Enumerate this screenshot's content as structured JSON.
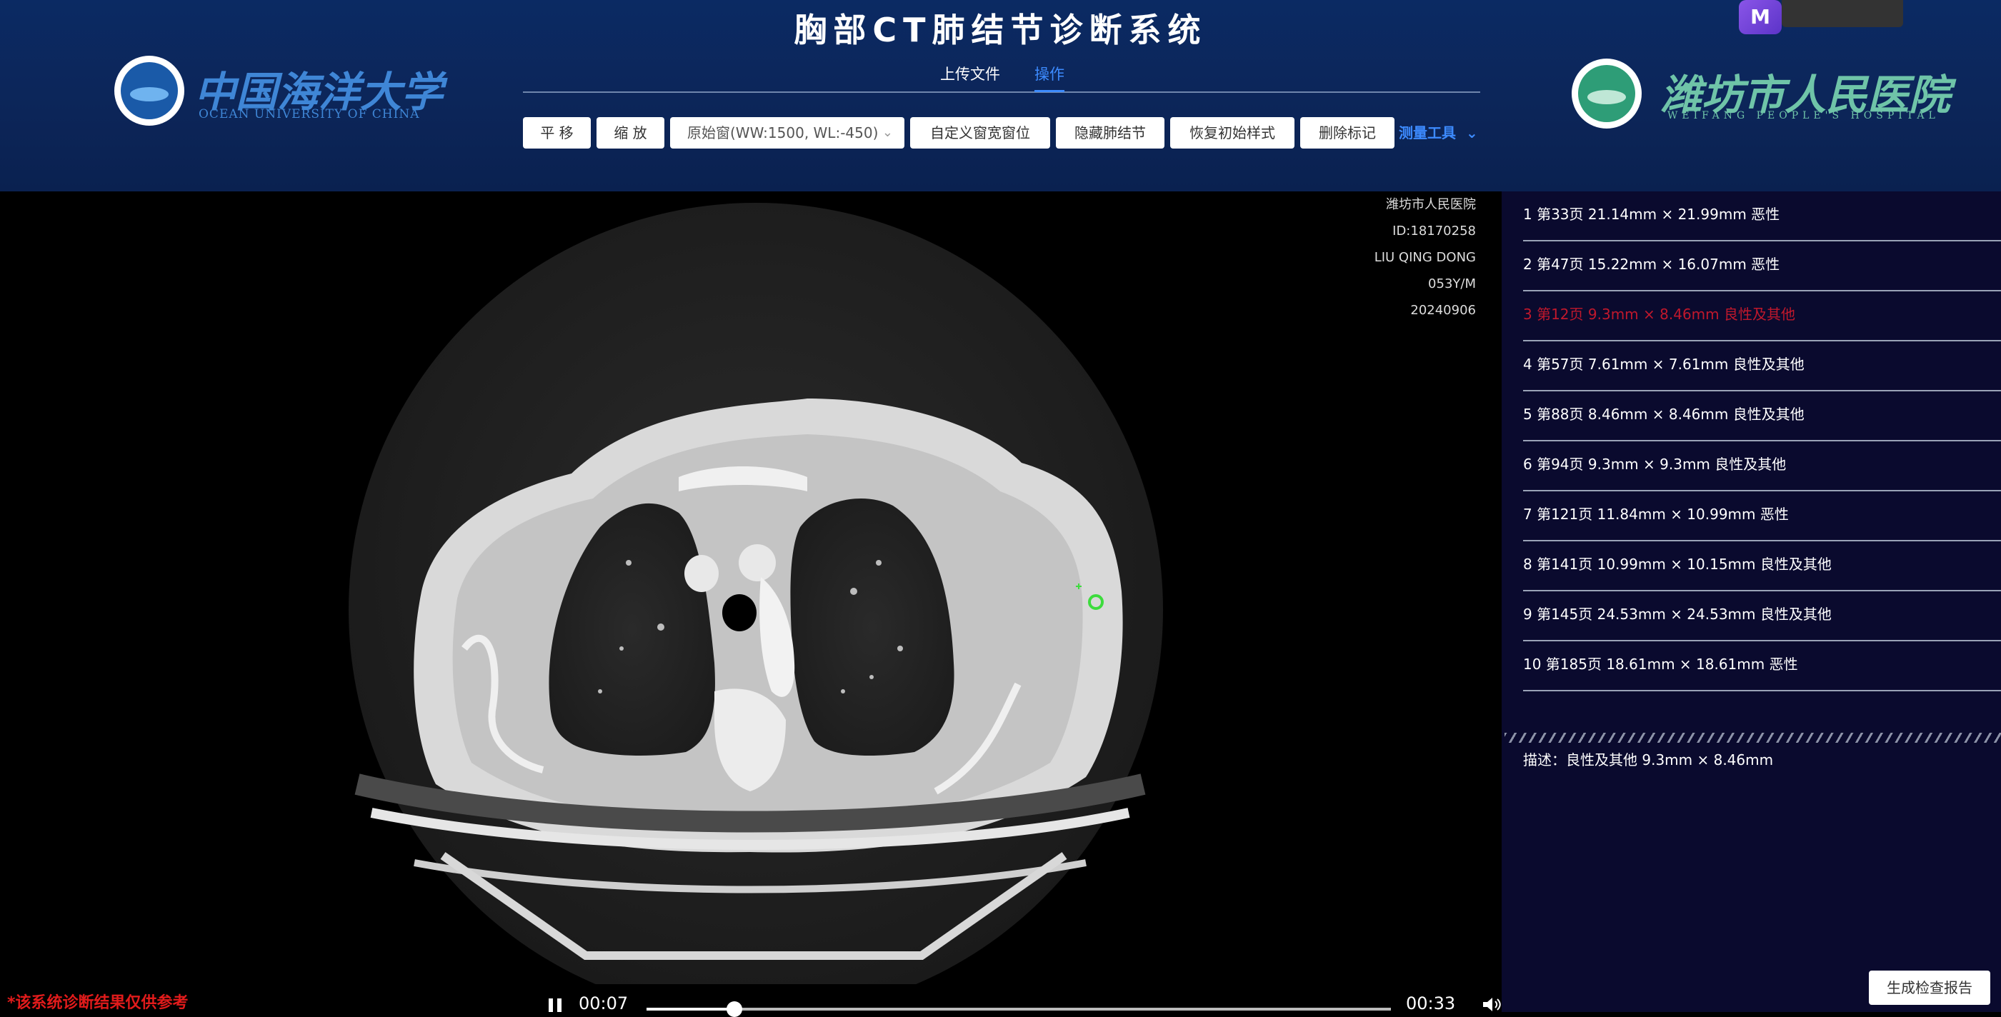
{
  "app": {
    "title": "胸部CT肺结节诊断系统",
    "logo_left": {
      "cn": "中国海洋大学",
      "en": "OCEAN UNIVERSITY OF CHINA",
      "seal": "OUC"
    },
    "logo_right": {
      "cn": "潍坊市人民医院",
      "en": "WEIFANG PEOPLE'S HOSPITAL"
    }
  },
  "tabs": [
    {
      "label": "上传文件",
      "active": false
    },
    {
      "label": "操作",
      "active": true
    }
  ],
  "toolbar": {
    "pan": "平 移",
    "zoom": "缩 放",
    "window_select": "原始窗(WW:1500, WL:-450)",
    "custom_window": "自定义窗宽窗位",
    "hide_nodules": "隐藏肺结节",
    "restore": "恢复初始样式",
    "delete_marks": "删除标记",
    "measure_tools": "测量工具"
  },
  "patient_info": {
    "hospital": "潍坊市人民医院",
    "id": "ID:18170258",
    "name": "LIU QING DONG",
    "age_sex": "053Y/M",
    "date": "20240906"
  },
  "nodules": [
    {
      "text": "1 第33页 21.14mm × 21.99mm 恶性",
      "selected": false
    },
    {
      "text": "2 第47页 15.22mm × 16.07mm 恶性",
      "selected": false
    },
    {
      "text": "3 第12页 9.3mm × 8.46mm 良性及其他",
      "selected": true
    },
    {
      "text": "4 第57页 7.61mm × 7.61mm 良性及其他",
      "selected": false
    },
    {
      "text": "5 第88页 8.46mm × 8.46mm 良性及其他",
      "selected": false
    },
    {
      "text": "6 第94页 9.3mm × 9.3mm 良性及其他",
      "selected": false
    },
    {
      "text": "7 第121页 11.84mm × 10.99mm 恶性",
      "selected": false
    },
    {
      "text": "8 第141页 10.99mm × 10.15mm 良性及其他",
      "selected": false
    },
    {
      "text": "9 第145页 24.53mm × 24.53mm 良性及其他",
      "selected": false
    },
    {
      "text": "10 第185页 18.61mm × 18.61mm 恶性",
      "selected": false
    }
  ],
  "description": "描述：良性及其他 9.3mm × 8.46mm",
  "report_button": "生成检查报告",
  "disclaimer": "*该系统诊断结果仅供参考",
  "player": {
    "current": "00:07",
    "duration": "00:33",
    "progress": 0.118
  },
  "colors": {
    "header_bg": "#0c2558",
    "accent": "#3d8bff",
    "panel_bg": "#0a0a2e",
    "selected": "#c0182c",
    "warning": "#e11b1b",
    "marker": "#3ddc3d"
  },
  "icons": {
    "pause": "pause-icon",
    "volume": "volume-icon",
    "chevron": "chevron-down-icon"
  }
}
